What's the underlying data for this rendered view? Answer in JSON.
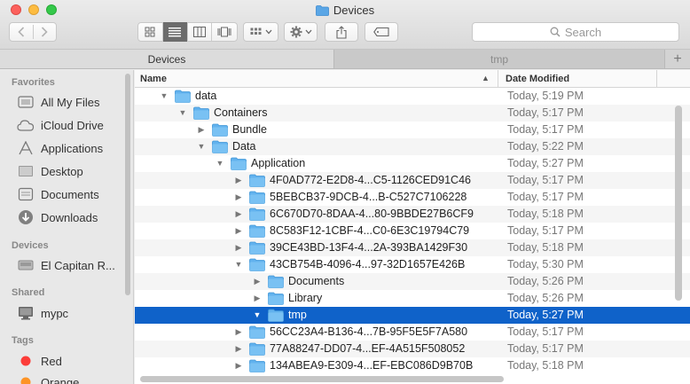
{
  "window": {
    "title": "Devices"
  },
  "toolbar": {
    "search_placeholder": "Search"
  },
  "tabs": [
    {
      "label": "Devices",
      "active": true
    },
    {
      "label": "tmp",
      "active": false
    }
  ],
  "sidebar": {
    "sections": [
      {
        "header": "Favorites",
        "items": [
          {
            "label": "All My Files",
            "icon": "all-my-files-icon"
          },
          {
            "label": "iCloud Drive",
            "icon": "icloud-icon"
          },
          {
            "label": "Applications",
            "icon": "applications-icon"
          },
          {
            "label": "Desktop",
            "icon": "desktop-icon"
          },
          {
            "label": "Documents",
            "icon": "documents-icon"
          },
          {
            "label": "Downloads",
            "icon": "downloads-icon"
          }
        ]
      },
      {
        "header": "Devices",
        "items": [
          {
            "label": "El Capitan R...",
            "icon": "disk-icon"
          }
        ]
      },
      {
        "header": "Shared",
        "items": [
          {
            "label": "mypc",
            "icon": "computer-icon"
          }
        ]
      },
      {
        "header": "Tags",
        "items": [
          {
            "label": "Red",
            "icon": "tag-red-icon",
            "color": "#fc3d39"
          },
          {
            "label": "Orange",
            "icon": "tag-orange-icon",
            "color": "#fd9426"
          }
        ]
      }
    ]
  },
  "columns": {
    "name": "Name",
    "date": "Date Modified"
  },
  "rows": [
    {
      "name": "data",
      "date": "Today, 5:19 PM",
      "level": 0,
      "expanded": true
    },
    {
      "name": "Containers",
      "date": "Today, 5:17 PM",
      "level": 1,
      "expanded": true
    },
    {
      "name": "Bundle",
      "date": "Today, 5:17 PM",
      "level": 2,
      "expanded": false
    },
    {
      "name": "Data",
      "date": "Today, 5:22 PM",
      "level": 2,
      "expanded": true
    },
    {
      "name": "Application",
      "date": "Today, 5:27 PM",
      "level": 3,
      "expanded": true
    },
    {
      "name": "4F0AD772-E2D8-4...C5-1126CED91C46",
      "date": "Today, 5:17 PM",
      "level": 4,
      "expanded": false
    },
    {
      "name": "5BEBCB37-9DCB-4...B-C527C7106228",
      "date": "Today, 5:17 PM",
      "level": 4,
      "expanded": false
    },
    {
      "name": "6C670D70-8DAA-4...80-9BBDE27B6CF9",
      "date": "Today, 5:18 PM",
      "level": 4,
      "expanded": false
    },
    {
      "name": "8C583F12-1CBF-4...C0-6E3C19794C79",
      "date": "Today, 5:17 PM",
      "level": 4,
      "expanded": false
    },
    {
      "name": "39CE43BD-13F4-4...2A-393BA1429F30",
      "date": "Today, 5:18 PM",
      "level": 4,
      "expanded": false
    },
    {
      "name": "43CB754B-4096-4...97-32D1657E426B",
      "date": "Today, 5:30 PM",
      "level": 4,
      "expanded": true
    },
    {
      "name": "Documents",
      "date": "Today, 5:26 PM",
      "level": 5,
      "expanded": false
    },
    {
      "name": "Library",
      "date": "Today, 5:26 PM",
      "level": 5,
      "expanded": false
    },
    {
      "name": "tmp",
      "date": "Today, 5:27 PM",
      "level": 5,
      "expanded": true,
      "selected": true
    },
    {
      "name": "56CC23A4-B136-4...7B-95F5E5F7A580",
      "date": "Today, 5:17 PM",
      "level": 4,
      "expanded": false
    },
    {
      "name": "77A88247-DD07-4...EF-4A515F508052",
      "date": "Today, 5:17 PM",
      "level": 4,
      "expanded": false
    },
    {
      "name": "134ABEA9-E309-4...EF-EBC086D9B70B",
      "date": "Today, 5:18 PM",
      "level": 4,
      "expanded": false
    }
  ]
}
